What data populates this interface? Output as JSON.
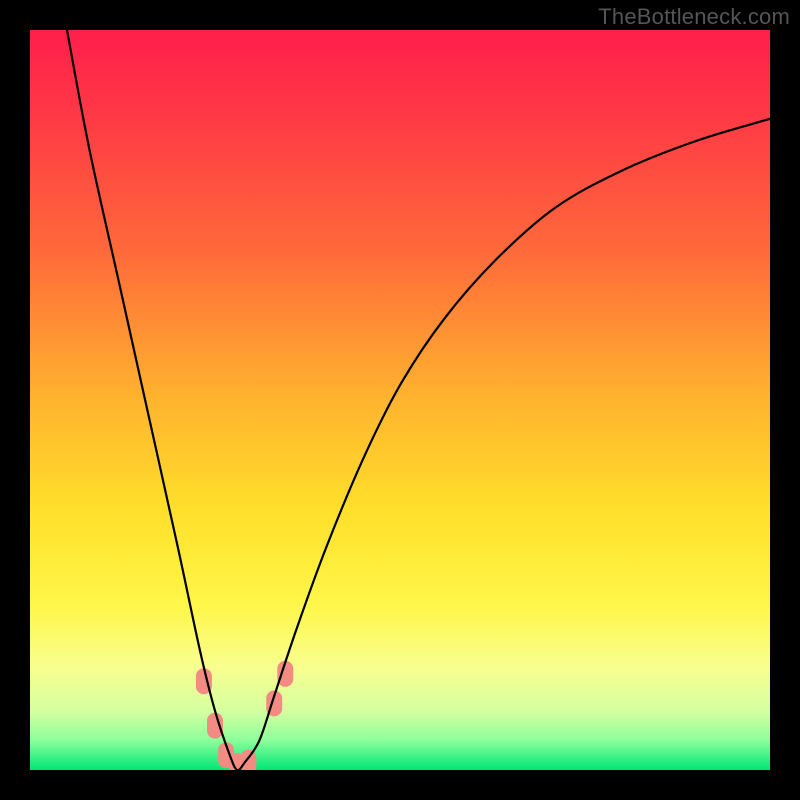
{
  "attribution": "TheBottleneck.com",
  "chart_data": {
    "type": "line",
    "title": "",
    "xlabel": "",
    "ylabel": "",
    "xlim": [
      0,
      100
    ],
    "ylim": [
      0,
      100
    ],
    "background_gradient": {
      "type": "vertical",
      "stops": [
        {
          "pos": 0.0,
          "color": "#ff1e4b"
        },
        {
          "pos": 0.12,
          "color": "#ff3a45"
        },
        {
          "pos": 0.3,
          "color": "#ff6a3a"
        },
        {
          "pos": 0.5,
          "color": "#ffb42e"
        },
        {
          "pos": 0.65,
          "color": "#ffe02a"
        },
        {
          "pos": 0.78,
          "color": "#fff74a"
        },
        {
          "pos": 0.86,
          "color": "#f8ff8e"
        },
        {
          "pos": 0.92,
          "color": "#d6ffa0"
        },
        {
          "pos": 0.96,
          "color": "#8cff9c"
        },
        {
          "pos": 1.0,
          "color": "#00e676"
        }
      ]
    },
    "curve": {
      "description": "Bottleneck percentage curve (V-shape). y is bottleneck %, x is relative component strength. Minimum near x≈28 where bottleneck≈0%.",
      "x": [
        5,
        8,
        12,
        16,
        20,
        23,
        25,
        27,
        28,
        29,
        31,
        33,
        36,
        40,
        45,
        50,
        56,
        63,
        71,
        80,
        90,
        100
      ],
      "y": [
        100,
        84,
        66,
        48,
        30,
        16,
        8,
        2,
        0,
        1,
        4,
        10,
        19,
        30,
        42,
        52,
        61,
        69,
        76,
        81,
        85,
        88
      ]
    },
    "markers": {
      "description": "Salmon rounded markers near the minimum of the curve",
      "color": "#f28b82",
      "points": [
        {
          "x": 23.5,
          "y": 12
        },
        {
          "x": 25.0,
          "y": 6
        },
        {
          "x": 26.5,
          "y": 2
        },
        {
          "x": 28.0,
          "y": 0.5
        },
        {
          "x": 29.5,
          "y": 1
        },
        {
          "x": 33.0,
          "y": 9
        },
        {
          "x": 34.5,
          "y": 13
        }
      ]
    }
  }
}
